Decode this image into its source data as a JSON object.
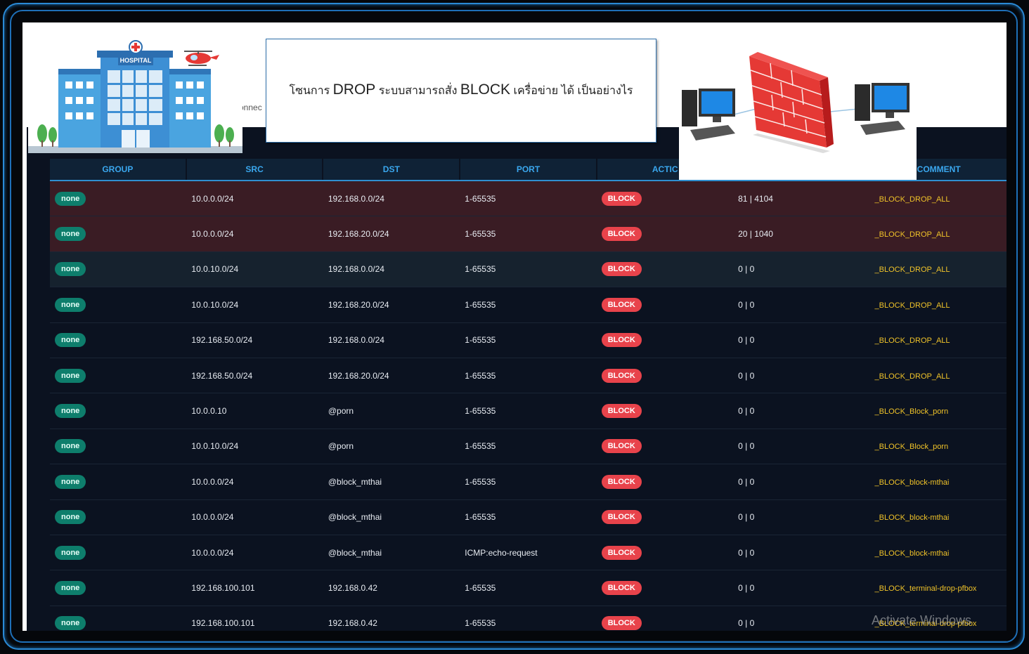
{
  "title": {
    "p1": "โซนการ ",
    "p2": "DROP",
    "p3": " ระบบสามารถสั่ง ",
    "p4": "BLOCK",
    "p5": " เครื่อข่าย ได้ เป็นอย่างไร"
  },
  "partial_label": "onnec",
  "hospital_sign": "HOSPITAL",
  "watermark": "Activate Windows",
  "columns": [
    "GROUP",
    "SRC",
    "DST",
    "PORT",
    "ACTIC",
    "",
    "COMMENT"
  ],
  "rows": [
    {
      "group": "none",
      "src": "10.0.0.0/24",
      "dst": "192.168.0.0/24",
      "port": "1-65535",
      "action": "BLOCK",
      "stats": "81 | 4104",
      "comment": "_BLOCK_DROP_ALL",
      "style": "hit"
    },
    {
      "group": "none",
      "src": "10.0.0.0/24",
      "dst": "192.168.20.0/24",
      "port": "1-65535",
      "action": "BLOCK",
      "stats": "20 | 1040",
      "comment": "_BLOCK_DROP_ALL",
      "style": "hit"
    },
    {
      "group": "none",
      "src": "10.0.10.0/24",
      "dst": "192.168.0.0/24",
      "port": "1-65535",
      "action": "BLOCK",
      "stats": "0 | 0",
      "comment": "_BLOCK_DROP_ALL",
      "style": "alt"
    },
    {
      "group": "none",
      "src": "10.0.10.0/24",
      "dst": "192.168.20.0/24",
      "port": "1-65535",
      "action": "BLOCK",
      "stats": "0 | 0",
      "comment": "_BLOCK_DROP_ALL",
      "style": ""
    },
    {
      "group": "none",
      "src": "192.168.50.0/24",
      "dst": "192.168.0.0/24",
      "port": "1-65535",
      "action": "BLOCK",
      "stats": "0 | 0",
      "comment": "_BLOCK_DROP_ALL",
      "style": ""
    },
    {
      "group": "none",
      "src": "192.168.50.0/24",
      "dst": "192.168.20.0/24",
      "port": "1-65535",
      "action": "BLOCK",
      "stats": "0 | 0",
      "comment": "_BLOCK_DROP_ALL",
      "style": ""
    },
    {
      "group": "none",
      "src": "10.0.0.10",
      "dst": "@porn",
      "port": "1-65535",
      "action": "BLOCK",
      "stats": "0 | 0",
      "comment": "_BLOCK_Block_porn",
      "style": ""
    },
    {
      "group": "none",
      "src": "10.0.10.0/24",
      "dst": "@porn",
      "port": "1-65535",
      "action": "BLOCK",
      "stats": "0 | 0",
      "comment": "_BLOCK_Block_porn",
      "style": ""
    },
    {
      "group": "none",
      "src": "10.0.0.0/24",
      "dst": "@block_mthai",
      "port": "1-65535",
      "action": "BLOCK",
      "stats": "0 | 0",
      "comment": "_BLOCK_block-mthai",
      "style": ""
    },
    {
      "group": "none",
      "src": "10.0.0.0/24",
      "dst": "@block_mthai",
      "port": "1-65535",
      "action": "BLOCK",
      "stats": "0 | 0",
      "comment": "_BLOCK_block-mthai",
      "style": ""
    },
    {
      "group": "none",
      "src": "10.0.0.0/24",
      "dst": "@block_mthai",
      "port": "ICMP:echo-request",
      "action": "BLOCK",
      "stats": "0 | 0",
      "comment": "_BLOCK_block-mthai",
      "style": ""
    },
    {
      "group": "none",
      "src": "192.168.100.101",
      "dst": "192.168.0.42",
      "port": "1-65535",
      "action": "BLOCK",
      "stats": "0 | 0",
      "comment": "_BLOCK_terminal-drop-pfbox",
      "style": ""
    },
    {
      "group": "none",
      "src": "192.168.100.101",
      "dst": "192.168.0.42",
      "port": "1-65535",
      "action": "BLOCK",
      "stats": "0 | 0",
      "comment": "_BLOCK_terminal-drop-pfbox",
      "style": ""
    }
  ]
}
